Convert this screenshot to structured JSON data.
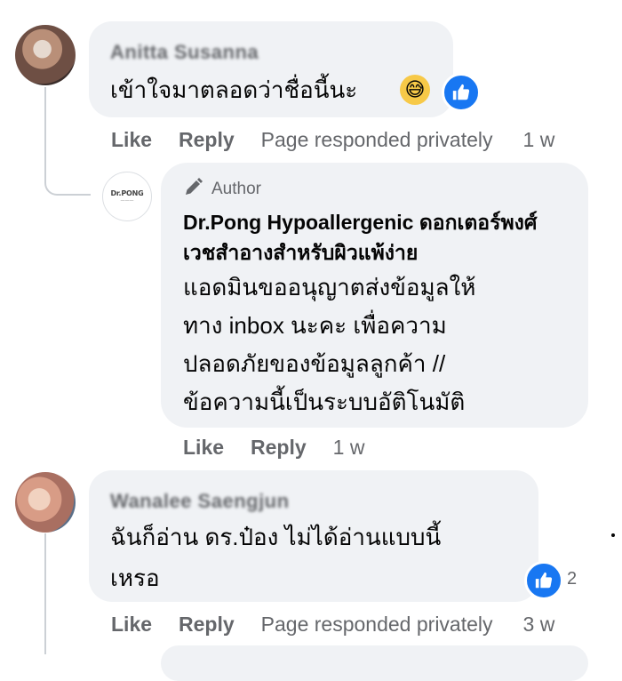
{
  "comments": [
    {
      "author": "Anitta Susanna",
      "text": "เข้าใจมาตลอดว่าชื่อนี้นะ",
      "actions": {
        "like": "Like",
        "reply": "Reply",
        "note": "Page responded privately",
        "time": "1 w"
      }
    },
    {
      "author": "Wanalee Saengjun",
      "text": "ฉันก็อ่าน ดร.ป๋อง ไม่ได้อ่านแบบนี้\nเหรอ",
      "reaction_count": "2",
      "actions": {
        "like": "Like",
        "reply": "Reply",
        "note": "Page responded privately",
        "time": "3 w"
      }
    }
  ],
  "reply": {
    "author_tag": "Author",
    "page_name": "Dr.Pong Hypoallergenic ดอกเตอร์พงศ์ เวชสำอางสำหรับผิวแพ้ง่าย",
    "avatar_logo": "Dr.PONG",
    "text": "แอดมินขออนุญาตส่งข้อมูลให้\nทาง inbox นะคะ เพื่อความ\nปลอดภัยของข้อมูลลูกค้า //\nข้อความนี้เป็นระบบอัติโนมัติ",
    "actions": {
      "like": "Like",
      "reply": "Reply",
      "time": "1 w"
    }
  },
  "icons": {
    "emoji": "grinning-sweat-emoji",
    "reaction": "like-reaction-icon",
    "author_badge": "pen-icon"
  },
  "colors": {
    "bubble": "#f0f2f5",
    "like_blue": "#1877f2",
    "meta_text": "#65676b"
  }
}
